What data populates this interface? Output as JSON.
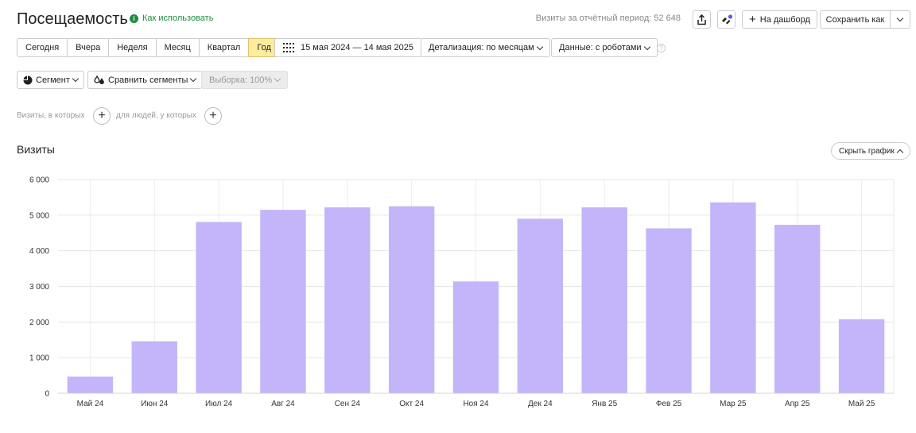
{
  "header": {
    "title": "Посещаемость",
    "how_to": "Как использовать",
    "period_summary": "Визиты за отчётный период: 52 648",
    "to_dashboard": "На дашборд",
    "save_as": "Сохранить как"
  },
  "periods": [
    "Сегодня",
    "Вчера",
    "Неделя",
    "Месяц",
    "Квартал",
    "Год"
  ],
  "active_period": "Год",
  "date_range": "15 мая 2024 — 14 мая 2025",
  "detail_select": "Детализация: по месяцам",
  "data_select": "Данные: с роботами",
  "segment_button": "Сегмент",
  "compare_button": "Сравнить сегменты",
  "sample_button": "Выборка: 100%",
  "filters": {
    "visits_label": "Визиты, в которых",
    "people_label": "для людей, у которых"
  },
  "chart": {
    "section_title": "Визиты",
    "hide_button": "Скрыть график"
  },
  "colors": {
    "bar": "#c4b5fa",
    "active_period": "#ffeba0",
    "link_green": "#1e8e3e"
  },
  "chart_data": {
    "type": "bar",
    "categories": [
      "Май 24",
      "Июн 24",
      "Июл 24",
      "Авг 24",
      "Сен 24",
      "Окт 24",
      "Ноя 24",
      "Дек 24",
      "Янв 25",
      "Фев 25",
      "Мар 25",
      "Апр 25",
      "Май 25"
    ],
    "values": [
      470,
      1460,
      4810,
      5150,
      5220,
      5250,
      3140,
      4900,
      5220,
      4630,
      5360,
      4730,
      2080
    ],
    "ylim": [
      0,
      6000
    ],
    "yticks": [
      0,
      1000,
      2000,
      3000,
      4000,
      5000,
      6000
    ],
    "ytick_labels": [
      "0",
      "1 000",
      "2 000",
      "3 000",
      "4 000",
      "5 000",
      "6 000"
    ],
    "grid": true,
    "legend": "none"
  }
}
